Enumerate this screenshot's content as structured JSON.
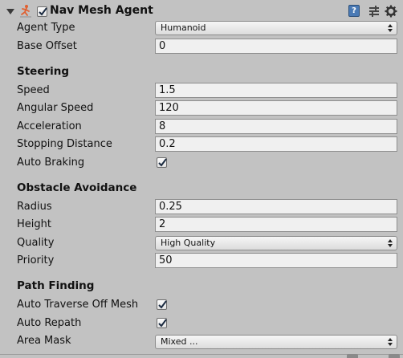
{
  "header": {
    "title": "Nav Mesh Agent",
    "enabled": true
  },
  "fields": {
    "agent_type": {
      "label": "Agent Type",
      "value": "Humanoid"
    },
    "base_offset": {
      "label": "Base Offset",
      "value": "0"
    }
  },
  "steering": {
    "title": "Steering",
    "speed": {
      "label": "Speed",
      "value": "1.5"
    },
    "angular_speed": {
      "label": "Angular Speed",
      "value": "120"
    },
    "acceleration": {
      "label": "Acceleration",
      "value": "8"
    },
    "stopping_distance": {
      "label": "Stopping Distance",
      "value": "0.2"
    },
    "auto_braking": {
      "label": "Auto Braking",
      "checked": true
    }
  },
  "obstacle_avoidance": {
    "title": "Obstacle Avoidance",
    "radius": {
      "label": "Radius",
      "value": "0.25"
    },
    "height": {
      "label": "Height",
      "value": "2"
    },
    "quality": {
      "label": "Quality",
      "value": "High Quality"
    },
    "priority": {
      "label": "Priority",
      "value": "50"
    }
  },
  "path_finding": {
    "title": "Path Finding",
    "auto_traverse_off_mesh": {
      "label": "Auto Traverse Off Mesh",
      "checked": true
    },
    "auto_repath": {
      "label": "Auto Repath",
      "checked": true
    },
    "area_mask": {
      "label": "Area Mask",
      "value": "Mixed ..."
    }
  },
  "icons": [
    "foldout-arrow-icon",
    "nav-mesh-agent-icon",
    "help-icon",
    "preset-icon",
    "gear-icon",
    "checkmark-icon",
    "dropdown-arrows-icon"
  ],
  "colors": {
    "panel": "#c2c2c2",
    "field": "#f0f0f0",
    "help_blue": "#4a7ab5"
  }
}
